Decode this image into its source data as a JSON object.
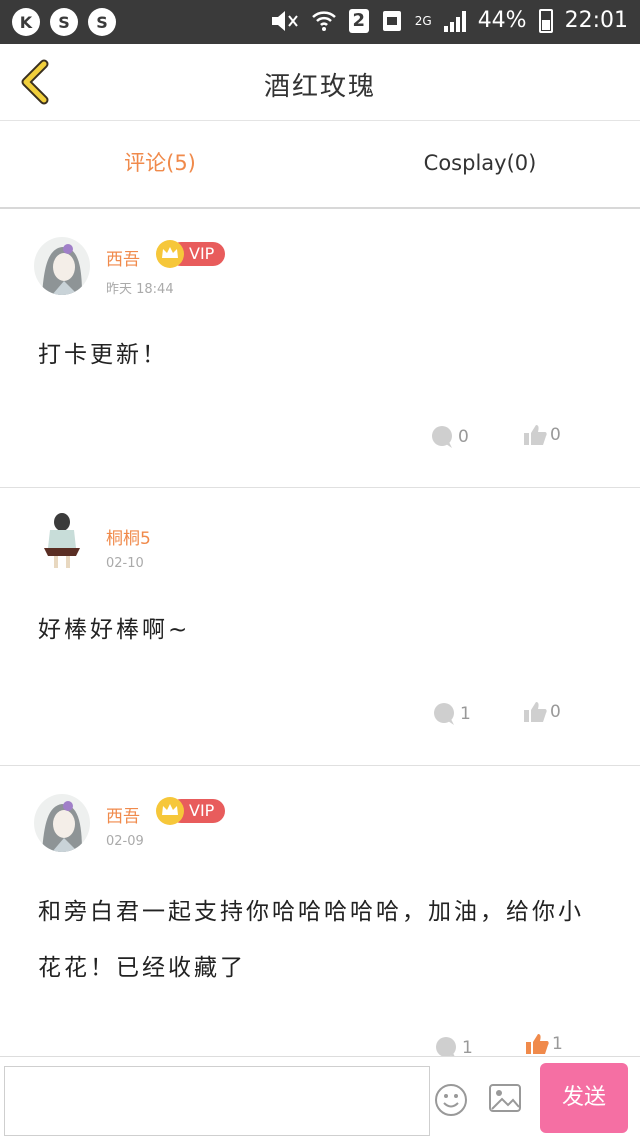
{
  "statusbar": {
    "badge": "2",
    "network": "2G",
    "battery": "44%",
    "time": "22:01"
  },
  "header": {
    "title": "酒红玫瑰"
  },
  "tabs": [
    {
      "label": "评论(5)"
    },
    {
      "label": "Cosplay(0)"
    }
  ],
  "comments": [
    {
      "user": "西吾",
      "vip": "VIP",
      "time": "昨天 18:44",
      "text": "打卡更新！",
      "replies": "0",
      "likes": "0"
    },
    {
      "user": "桐桐5",
      "vip": "",
      "time": "02-10",
      "text": "好棒好棒啊~",
      "replies": "1",
      "likes": "0"
    },
    {
      "user": "西吾",
      "vip": "VIP",
      "time": "02-09",
      "text": "和旁白君一起支持你哈哈哈哈哈，加油，给你小花花！已经收藏了",
      "replies": "1",
      "likes": "1"
    }
  ],
  "inputbar": {
    "placeholder": "",
    "send_label": "发送"
  },
  "colors": {
    "accent": "#f08a4b",
    "vip": "#e85c5c",
    "send": "#f56fa3"
  }
}
